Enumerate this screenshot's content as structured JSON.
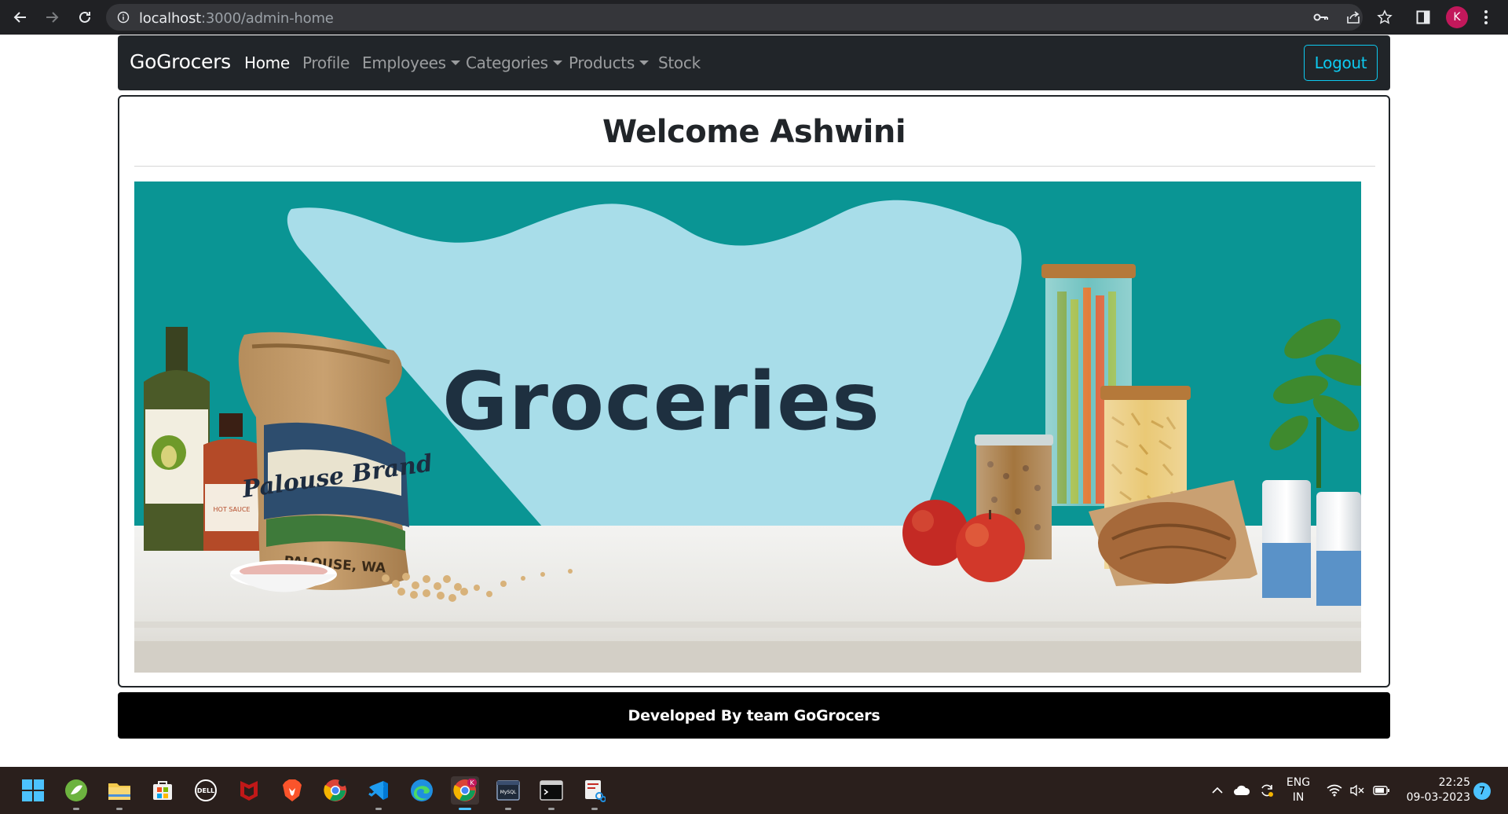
{
  "browser": {
    "url_host": "localhost",
    "url_path": ":3000/admin-home",
    "profile_initial": "K"
  },
  "navbar": {
    "brand": "GoGrocers",
    "items": [
      {
        "label": "Home",
        "active": true,
        "dropdown": false
      },
      {
        "label": "Profile",
        "active": false,
        "dropdown": false
      },
      {
        "label": "Employees",
        "active": false,
        "dropdown": true
      },
      {
        "label": "Categories",
        "active": false,
        "dropdown": true
      },
      {
        "label": "Products",
        "active": false,
        "dropdown": true
      },
      {
        "label": "Stock",
        "active": false,
        "dropdown": false
      }
    ],
    "logout_label": "Logout"
  },
  "main": {
    "welcome": "Welcome Ashwini",
    "banner": {
      "title": "Groceries",
      "sack_brand": "Palouse Brand",
      "sack_location": "PALOUSE, WA",
      "sauce_label": "HOT SAUCE"
    }
  },
  "footer": {
    "text": "Developed By team GoGrocers"
  },
  "taskbar": {
    "apps": [
      "windows-start",
      "spring-tool",
      "file-explorer",
      "microsoft-store",
      "dell",
      "mcafee",
      "brave",
      "chrome",
      "vscode",
      "edge",
      "chrome-profile-k",
      "mysql",
      "terminal",
      "snipping-tool"
    ],
    "lang_line1": "ENG",
    "lang_line2": "IN",
    "time": "22:25",
    "date": "09-03-2023",
    "notification_count": "7"
  },
  "colors": {
    "navbar_bg": "#212529",
    "logout_accent": "#0dcaf0",
    "banner_teal": "#0a9594",
    "banner_light_blue": "#a8dde9",
    "footer_bg": "#000000"
  }
}
